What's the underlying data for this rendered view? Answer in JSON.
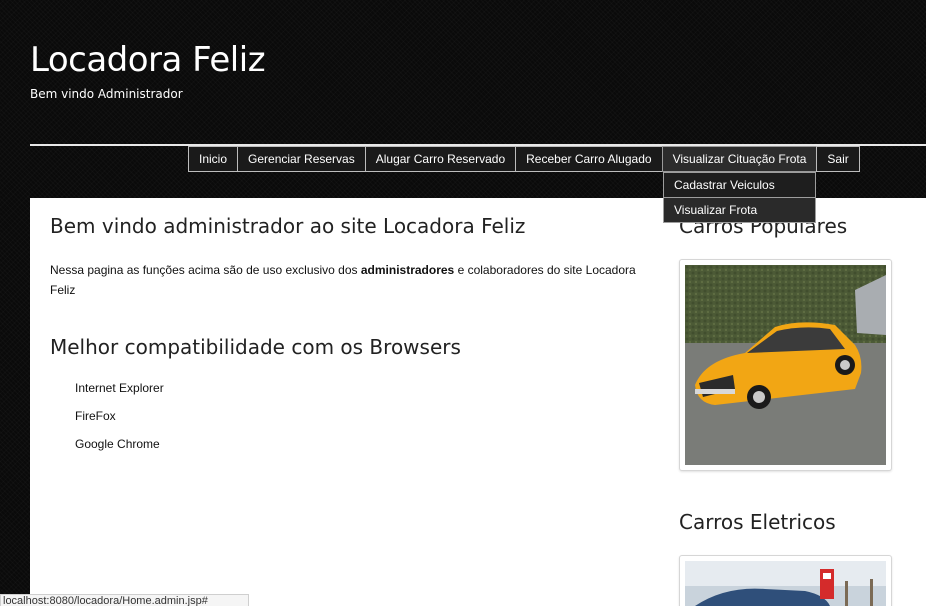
{
  "header": {
    "title": "Locadora Feliz",
    "subtitle": "Bem vindo Administrador"
  },
  "nav": {
    "items": [
      {
        "label": "Inicio"
      },
      {
        "label": "Gerenciar Reservas"
      },
      {
        "label": "Alugar Carro Reservado"
      },
      {
        "label": "Receber Carro Alugado"
      },
      {
        "label": "Visualizar Cituação Frota"
      },
      {
        "label": "Sair"
      }
    ],
    "dropdown": [
      {
        "label": "Cadastrar Veiculos"
      },
      {
        "label": "Visualizar Frota"
      }
    ]
  },
  "main": {
    "title": "Bem vindo administrador ao site Locadora Feliz",
    "intro_before": "Nessa pagina as funções acima são de uso exclusivo dos ",
    "intro_bold": "administradores",
    "intro_after": " e colaboradores do site Locadora Feliz",
    "compat_title": "Melhor compatibilidade com os Browsers",
    "browsers": [
      "Internet Explorer",
      "FireFox",
      "Google Chrome"
    ]
  },
  "sidebar": {
    "popular_title": "Carros Populares",
    "electric_title": "Carros Eletricos"
  },
  "status": {
    "text": "localhost:8080/locadora/Home.admin.jsp#"
  },
  "colors": {
    "background": "#0b0b0b",
    "content_bg": "#ffffff",
    "car_yellow": "#f2a614",
    "sign_red": "#d42b2b"
  }
}
